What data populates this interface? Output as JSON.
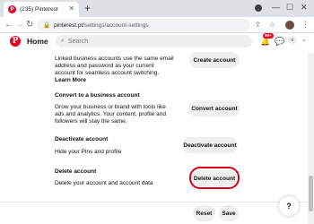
{
  "browser": {
    "tab_title": "(235) Pinterest",
    "tab_favicon": "P",
    "new_tab": "+",
    "url_host": "pinterest.pt",
    "url_path": "/settings/account-settings",
    "window": {
      "minimize": "—",
      "maximize": "☐",
      "close": "✕"
    }
  },
  "header": {
    "logo": "P",
    "home_label": "Home",
    "search_placeholder": "Search",
    "notification_badge": "99+",
    "avatar_initial": "c"
  },
  "content": {
    "switch_desc": [
      "Linked business accounts use the same email",
      "address and password as your current",
      "account for seamless account switching."
    ],
    "learn_more": "Learn More",
    "create_account_label": "Create account",
    "convert_title": "Convert to a business account",
    "convert_desc": [
      "Grow your business or brand with tools like",
      "ads and analytics. Your content, profile and",
      "followers will stay the same."
    ],
    "convert_account_label": "Convert account",
    "deactivate_title": "Deactivate account",
    "deactivate_desc": "Hide your Pins and profile",
    "deactivate_account_label": "Deactivate account",
    "delete_title": "Delete account",
    "delete_desc": "Delete your account and account data",
    "delete_account_label": "Delete account"
  },
  "footer": {
    "reset_label": "Reset",
    "save_label": "Save",
    "help_label": "?"
  },
  "colors": {
    "brand": "#e60023",
    "highlight": "#d9001b",
    "button_bg": "#efefef"
  }
}
